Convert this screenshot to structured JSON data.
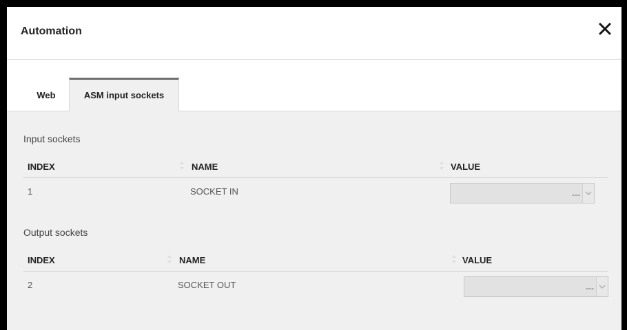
{
  "dialog": {
    "title": "Automation"
  },
  "tabs": [
    {
      "label": "Web",
      "active": false
    },
    {
      "label": "ASM input sockets",
      "active": true
    }
  ],
  "input_sockets": {
    "title": "Input sockets",
    "columns": [
      "INDEX",
      "NAME",
      "VALUE"
    ],
    "rows": [
      {
        "index": "1",
        "name": "SOCKET IN",
        "value": "---"
      }
    ]
  },
  "output_sockets": {
    "title": "Output sockets",
    "columns": [
      "INDEX",
      "NAME",
      "VALUE"
    ],
    "rows": [
      {
        "index": "2",
        "name": "SOCKET OUT",
        "value": "---"
      }
    ]
  },
  "icons": {
    "close": "close-icon",
    "sort": "sort-icon",
    "dropdown": "chevron-down-icon"
  },
  "colors": {
    "panel_background": "#f0f0f0",
    "header_background": "#ffffff",
    "active_tab_border": "#6e6e6e",
    "select_background": "#e2e2e2"
  }
}
